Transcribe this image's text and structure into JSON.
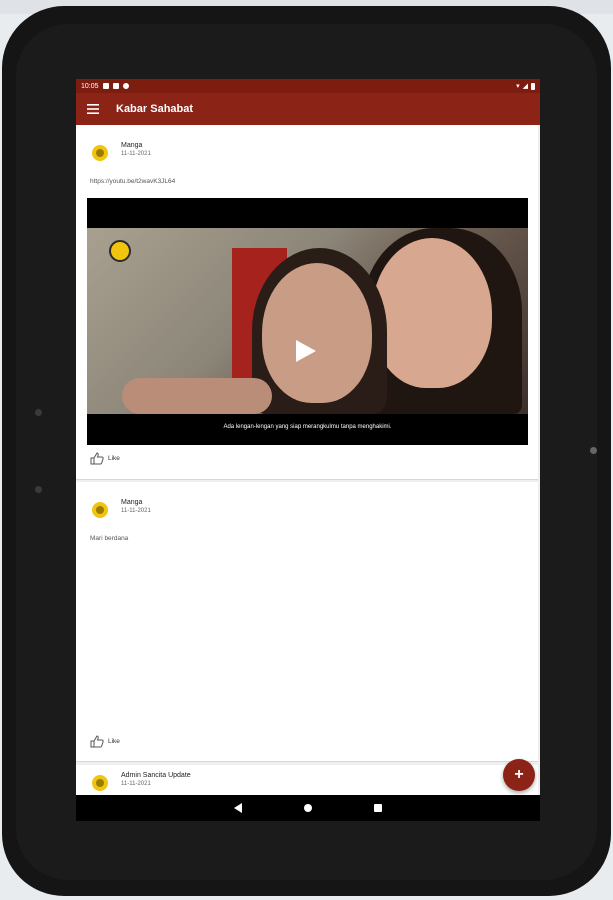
{
  "status_bar": {
    "time": "10:05"
  },
  "app_bar": {
    "title": "Kabar Sahabat"
  },
  "posts": [
    {
      "author": "Manga",
      "date": "11-11-2021",
      "text": "https://youtu.be/t2wavK3JL64",
      "video": {
        "caption": "Ada lengan-lengan yang siap merangkulmu tanpa menghakimi."
      },
      "like_label": "Like"
    },
    {
      "author": "Manga",
      "date": "11-11-2021",
      "text": "Mari berdana",
      "like_label": "Like"
    },
    {
      "author": "Admin Sancita Update",
      "date": "11-11-2021"
    }
  ],
  "fab": {
    "label": "+"
  },
  "nav_bar": {
    "icons": [
      "back-icon",
      "home-icon",
      "recents-icon"
    ]
  },
  "colors": {
    "primary": "#8b2316",
    "status_bar": "#7d1d10",
    "accent_avatar": "#f1c40f"
  }
}
